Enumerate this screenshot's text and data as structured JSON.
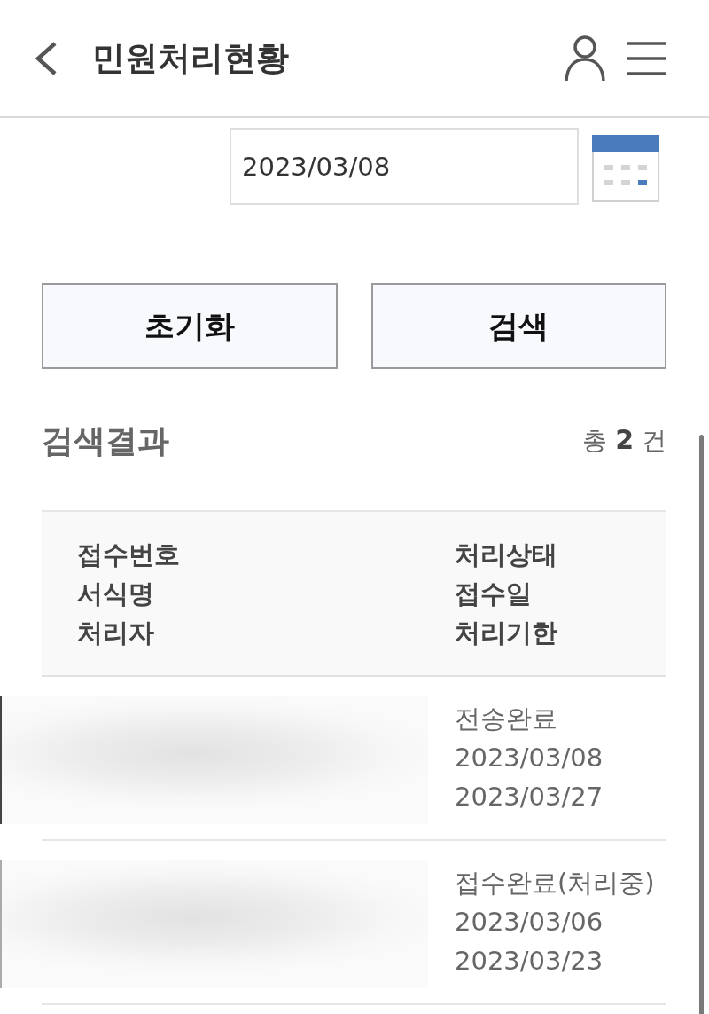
{
  "header": {
    "title": "민원처리현황"
  },
  "date_field": {
    "value": "2023/03/08"
  },
  "buttons": [
    {
      "label": "초기화"
    },
    {
      "label": "검색"
    }
  ],
  "results": {
    "title": "검색결과",
    "count": "총 **2** 건"
  },
  "table": {
    "columns_left": [
      "접수번호",
      "서식명",
      "처리자"
    ],
    "columns_right": [
      "처리상태",
      "접수일",
      "처리기한"
    ],
    "rows": [
      {
        "status": "전송완료",
        "received_date": "2023/03/08",
        "deadline": "2023/03/27"
      },
      {
        "status": "접수완료(처리중)",
        "received_date": "2023/03/06",
        "deadline": "2023/03/23"
      }
    ]
  }
}
